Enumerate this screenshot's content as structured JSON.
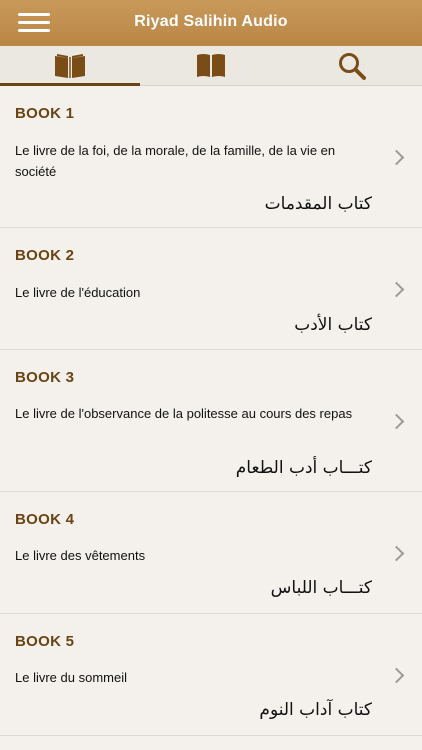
{
  "header": {
    "title": "Riyad Salihin Audio",
    "menu_icon": "hamburger-menu-icon"
  },
  "tabs": [
    {
      "icon": "open-book-icon",
      "active": true
    },
    {
      "icon": "closed-book-icon",
      "active": false
    },
    {
      "icon": "search-icon",
      "active": false
    }
  ],
  "colors": {
    "header": "#c99a5a",
    "accent": "#6b4413",
    "tab_icon": "#7a4d17"
  },
  "books": [
    {
      "label": "BOOK 1",
      "fr": "Le livre de la foi, de la morale, de la famille, de la vie en société",
      "ar": "كتاب المقدمات"
    },
    {
      "label": "BOOK 2",
      "fr": "Le livre de l'éducation",
      "ar": "كتاب الأدب"
    },
    {
      "label": "BOOK 3",
      "fr": "Le livre de l'observance de la politesse au cours des repas",
      "ar": "كتـــاب أدب الطعام"
    },
    {
      "label": "BOOK 4",
      "fr": "Le livre des vêtements",
      "ar": "كتـــاب اللباس"
    },
    {
      "label": "BOOK 5",
      "fr": "Le livre du sommeil",
      "ar": "كتاب آداب النوم"
    }
  ]
}
